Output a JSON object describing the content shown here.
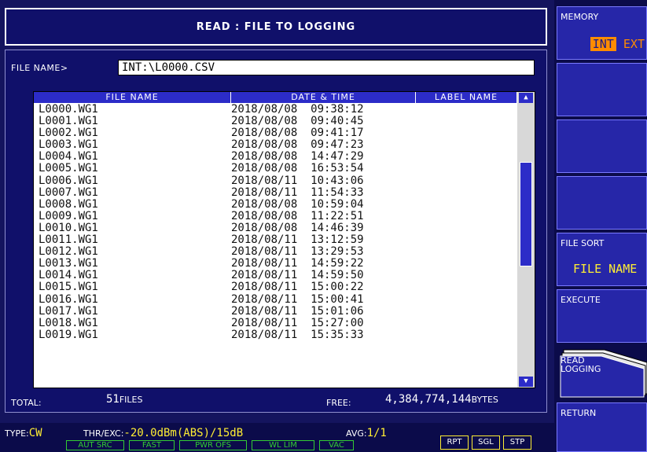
{
  "title": "READ : FILE TO LOGGING",
  "file_name": {
    "label": "FILE NAME>",
    "value": "INT:\\L0000.CSV"
  },
  "columns": [
    "FILE NAME",
    "DATE & TIME",
    "LABEL NAME"
  ],
  "files": [
    {
      "name": "L0000.WG1",
      "date": "2018/08/08  09:38:12"
    },
    {
      "name": "L0001.WG1",
      "date": "2018/08/08  09:40:45"
    },
    {
      "name": "L0002.WG1",
      "date": "2018/08/08  09:41:17"
    },
    {
      "name": "L0003.WG1",
      "date": "2018/08/08  09:47:23"
    },
    {
      "name": "L0004.WG1",
      "date": "2018/08/08  14:47:29"
    },
    {
      "name": "L0005.WG1",
      "date": "2018/08/08  16:53:54"
    },
    {
      "name": "L0006.WG1",
      "date": "2018/08/11  10:43:06"
    },
    {
      "name": "L0007.WG1",
      "date": "2018/08/11  11:54:33"
    },
    {
      "name": "L0008.WG1",
      "date": "2018/08/08  10:59:04"
    },
    {
      "name": "L0009.WG1",
      "date": "2018/08/08  11:22:51"
    },
    {
      "name": "L0010.WG1",
      "date": "2018/08/08  14:46:39"
    },
    {
      "name": "L0011.WG1",
      "date": "2018/08/11  13:12:59"
    },
    {
      "name": "L0012.WG1",
      "date": "2018/08/11  13:29:53"
    },
    {
      "name": "L0013.WG1",
      "date": "2018/08/11  14:59:22"
    },
    {
      "name": "L0014.WG1",
      "date": "2018/08/11  14:59:50"
    },
    {
      "name": "L0015.WG1",
      "date": "2018/08/11  15:00:22"
    },
    {
      "name": "L0016.WG1",
      "date": "2018/08/11  15:00:41"
    },
    {
      "name": "L0017.WG1",
      "date": "2018/08/11  15:01:06"
    },
    {
      "name": "L0018.WG1",
      "date": "2018/08/11  15:27:00"
    },
    {
      "name": "L0019.WG1",
      "date": "2018/08/11  15:35:33"
    }
  ],
  "scroll_position": 0.35,
  "total": {
    "label": "TOTAL:",
    "value": "51",
    "unit": "FILES"
  },
  "free": {
    "label": "FREE:",
    "value": "4,384,774,144",
    "unit": "BYTES"
  },
  "status": {
    "type_label": "TYPE:",
    "type_value": "CW",
    "thr_label": "THR/EXC:",
    "thr_value": "-20.0dBm(ABS)/15dB",
    "avg_label": "AVG:",
    "avg_value": "1/1",
    "indicators": [
      "AUT SRC",
      "FAST",
      "PWR OFS",
      "WL LIM",
      "VAC"
    ],
    "modes": [
      "RPT",
      "SGL",
      "STP"
    ]
  },
  "softkeys": {
    "memory": {
      "label": "MEMORY",
      "int": "INT",
      "ext": "EXT"
    },
    "file_sort": {
      "label": "FILE SORT",
      "value": "FILE NAME"
    },
    "execute": "EXECUTE",
    "read_logging": "READ\nLOGGING",
    "return": "RETURN"
  },
  "colors": {
    "background": "#0b0b4a",
    "panel": "#14145e",
    "accent": "#2c2cc8",
    "value": "#ffee33",
    "indicator": "#33cc33",
    "memory_active": "#ff8c00"
  }
}
